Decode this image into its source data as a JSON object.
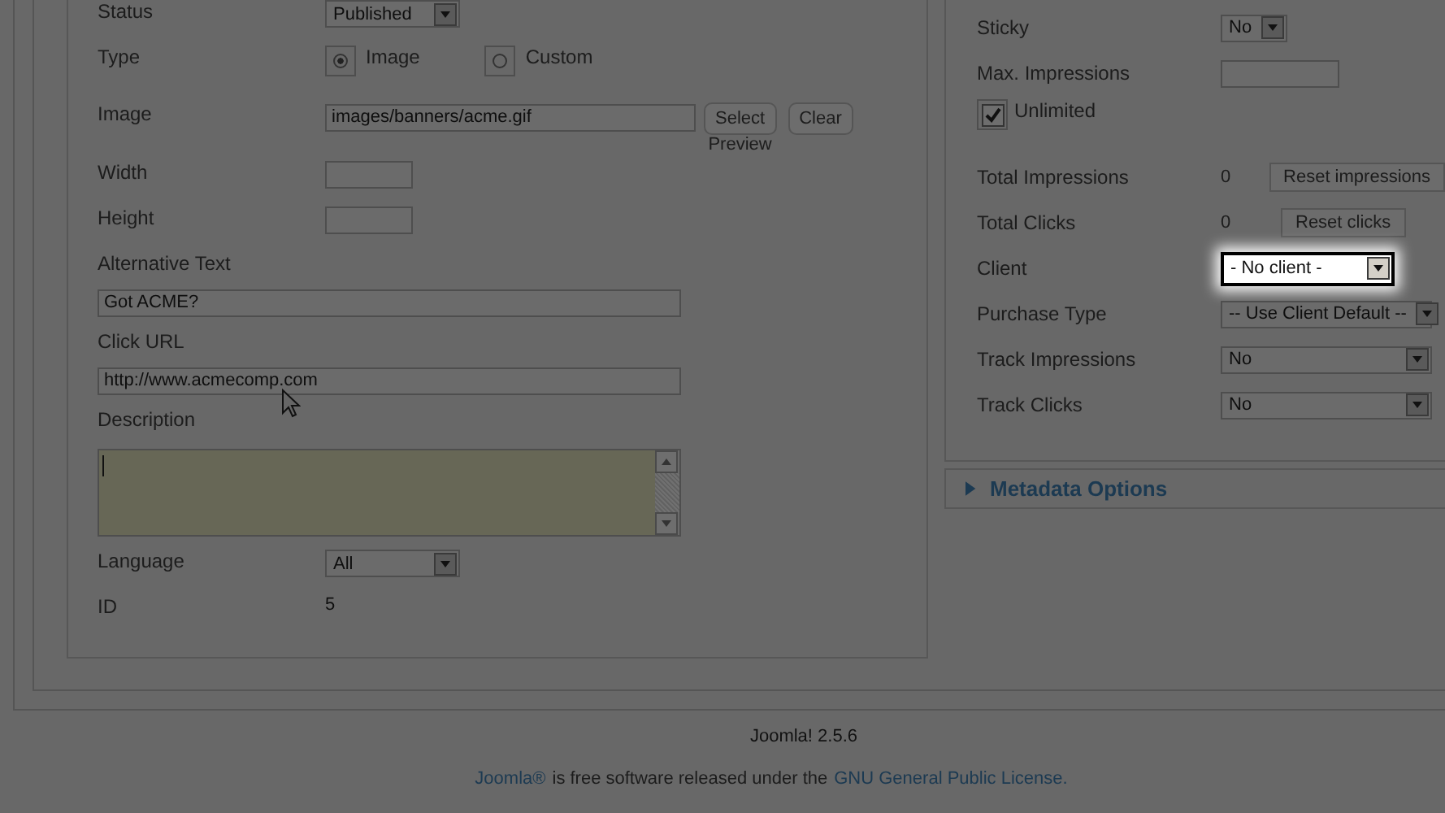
{
  "left_fields": [
    {
      "kind": "select",
      "label": "Status",
      "value": "Published"
    },
    {
      "kind": "radio",
      "label": "Type",
      "options": [
        {
          "label": "Image",
          "selected": true
        },
        {
          "label": "Custom",
          "selected": false
        }
      ]
    },
    {
      "kind": "image",
      "label": "Image",
      "value": "images/banners/acme.gif",
      "buttons": [
        "Select",
        "Clear"
      ],
      "caption": "Preview"
    },
    {
      "kind": "small_input",
      "label": "Width"
    },
    {
      "kind": "small_input",
      "label": "Height"
    },
    {
      "kind": "wide_input",
      "label": "Alternative Text",
      "value": "Got ACME?"
    },
    {
      "kind": "wide_input",
      "label": "Click URL",
      "value": "http://www.acmecomp.com"
    },
    {
      "kind": "textarea",
      "label": "Description"
    },
    {
      "kind": "select",
      "label": "Language",
      "value": "All"
    },
    {
      "kind": "text",
      "label": "ID",
      "value": "5"
    }
  ],
  "right_fields": [
    {
      "kind": "select",
      "label": "Sticky",
      "value": "No"
    },
    {
      "kind": "input",
      "label": "Max. Impressions"
    },
    {
      "kind": "checkbox",
      "label": "Unlimited",
      "checked": true
    },
    {
      "kind": "counter",
      "label": "Total Impressions",
      "value": "0",
      "button": "Reset impressions"
    },
    {
      "kind": "counter",
      "label": "Total Clicks",
      "value": "0",
      "button": "Reset clicks"
    },
    {
      "kind": "select",
      "label": "Client",
      "value": "- No client -",
      "highlighted": true
    },
    {
      "kind": "wide_select",
      "label": "Purchase Type",
      "value": "-- Use Client Default --"
    },
    {
      "kind": "wide_select",
      "label": "Track Impressions",
      "value": "No"
    },
    {
      "kind": "wide_select",
      "label": "Track Clicks",
      "value": "No"
    }
  ],
  "metadata_panel": {
    "title": "Metadata Options",
    "expanded": false
  },
  "version": "Joomla! 2.5.6",
  "footer": {
    "link": "Joomla®",
    "text": "is free software released under the",
    "license": "GNU General Public License."
  }
}
